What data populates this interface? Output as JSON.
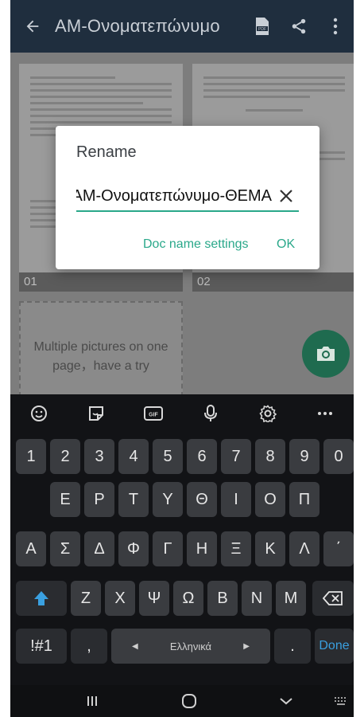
{
  "appbar": {
    "back_icon": "arrow-left-icon",
    "title": "ΑΜ-Ονοματεπώνυμο",
    "actions": [
      "pdf-icon",
      "share-icon",
      "more-vert-icon"
    ]
  },
  "pages": [
    {
      "number": "01"
    },
    {
      "number": "02"
    }
  ],
  "placeholder": {
    "line1": "Multiple pictures on one",
    "line2": "page，have a try"
  },
  "fab": {
    "icon": "camera-icon"
  },
  "dialog": {
    "title": "Rename",
    "value": "ΑΜ-Ονοματεπώνυμο-ΘΕΜΑ",
    "clear_icon": "close-icon",
    "settings_label": "Doc name settings",
    "ok_label": "OK",
    "accent": "#2aa88a"
  },
  "keyboard": {
    "toolbar": [
      "emoji-icon",
      "sticker-icon",
      "gif-icon",
      "mic-icon",
      "settings-icon",
      "more-icon"
    ],
    "row_numbers": [
      "1",
      "2",
      "3",
      "4",
      "5",
      "6",
      "7",
      "8",
      "9",
      "0"
    ],
    "row1": [
      "Ε",
      "Ρ",
      "Τ",
      "Υ",
      "Θ",
      "Ι",
      "Ο",
      "Π"
    ],
    "row2": [
      "Α",
      "Σ",
      "Δ",
      "Φ",
      "Γ",
      "Η",
      "Ξ",
      "Κ",
      "Λ",
      "΄"
    ],
    "row3": [
      "Ζ",
      "Χ",
      "Ψ",
      "Ω",
      "Β",
      "Ν",
      "Μ"
    ],
    "symbols_label": "!#1",
    "comma_label": ",",
    "space_label": "Ελληνικά",
    "period_label": ".",
    "done_label": "Done",
    "shift_icon": "shift-up-icon",
    "backspace_icon": "backspace-icon"
  },
  "navbar": [
    "recents-icon",
    "home-icon",
    "back-chevron-icon",
    "keyboard-switch-icon"
  ]
}
